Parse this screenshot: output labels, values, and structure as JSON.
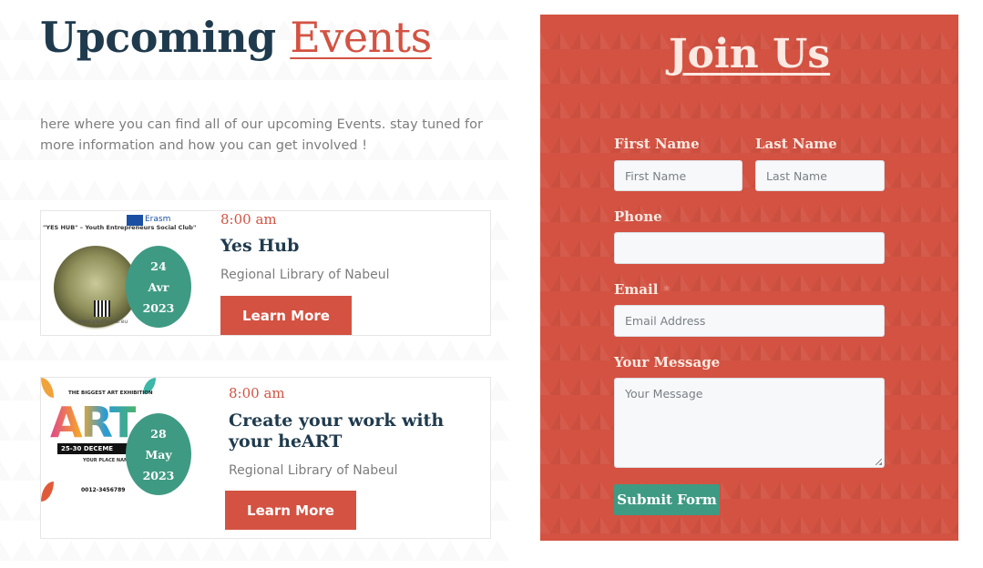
{
  "section": {
    "title_main": "Upcoming",
    "title_accent": "Events",
    "intro": "here where you can find all of our upcoming Events. stay tuned for more information and how you can get involved !"
  },
  "events": [
    {
      "day": "24",
      "month": "Avr",
      "year": "2023",
      "time": "8:00 am",
      "title": "Yes Hub",
      "venue": "Regional Library of Nabeul",
      "button_label": "Learn More",
      "poster": {
        "title_text": "\"YES HUB\" – Youth Entrepreneurs Social Club\"",
        "logo_text": "Erasm",
        "url_text": "www.youthclub.eu"
      }
    },
    {
      "day": "28",
      "month": "May",
      "year": "2023",
      "time": "8:00 am",
      "title": "Create your work with your heART",
      "venue": "Regional Library of Nabeul",
      "button_label": "Learn More",
      "poster": {
        "header_text": "THE BIGGEST ART EXHIBITION",
        "big_text": "ART",
        "band_text": "25-30 DECEME",
        "place_text": "YOUR PLACE NAME",
        "phone_text": "0012-3456789"
      }
    }
  ],
  "join_form": {
    "title": "Join Us",
    "first_name_label": "First Name",
    "first_name_placeholder": "First Name",
    "last_name_label": "Last Name",
    "last_name_placeholder": "Last Name",
    "phone_label": "Phone",
    "email_label": "Email",
    "email_required_mark": "*",
    "email_placeholder": "Email Address",
    "message_label": "Your Message",
    "message_placeholder": "Your Message",
    "submit_label": "Submit Form"
  },
  "colors": {
    "accent_red": "#d35242",
    "teal": "#3f9a83",
    "navy": "#1f3a4d"
  }
}
